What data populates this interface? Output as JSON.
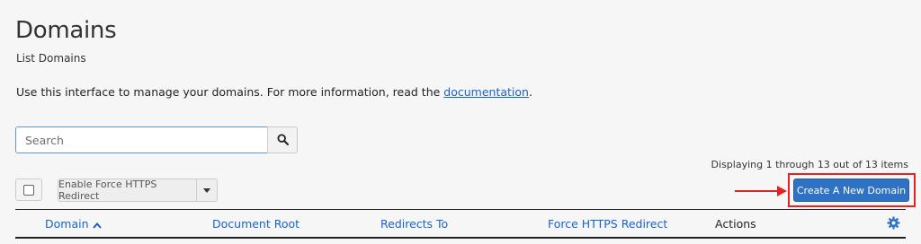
{
  "header": {
    "title": "Domains",
    "subtitle": "List Domains"
  },
  "intro": {
    "text": "Use this interface to manage your domains. For more information, read the ",
    "link": "documentation",
    "end": "."
  },
  "search": {
    "placeholder": "Search",
    "value": "",
    "button_icon": "search-icon"
  },
  "toolbar": {
    "display_count": "Displaying 1 through 13 out of 13 items",
    "https_label": "Enable Force HTTPS Redirect",
    "create_label": "Create A New Domain"
  },
  "table": {
    "columns": [
      {
        "label": "Domain",
        "sort": "ascending"
      },
      {
        "label": "Document Root"
      },
      {
        "label": "Redirects To"
      },
      {
        "label": "Force HTTPS Redirect"
      },
      {
        "label": "Actions"
      }
    ],
    "settings_icon": "gear-icon"
  },
  "colors": {
    "primary": "#2f72c4",
    "link": "#1863c8",
    "annotation": "#e02424",
    "background": "#f6f6f6"
  }
}
